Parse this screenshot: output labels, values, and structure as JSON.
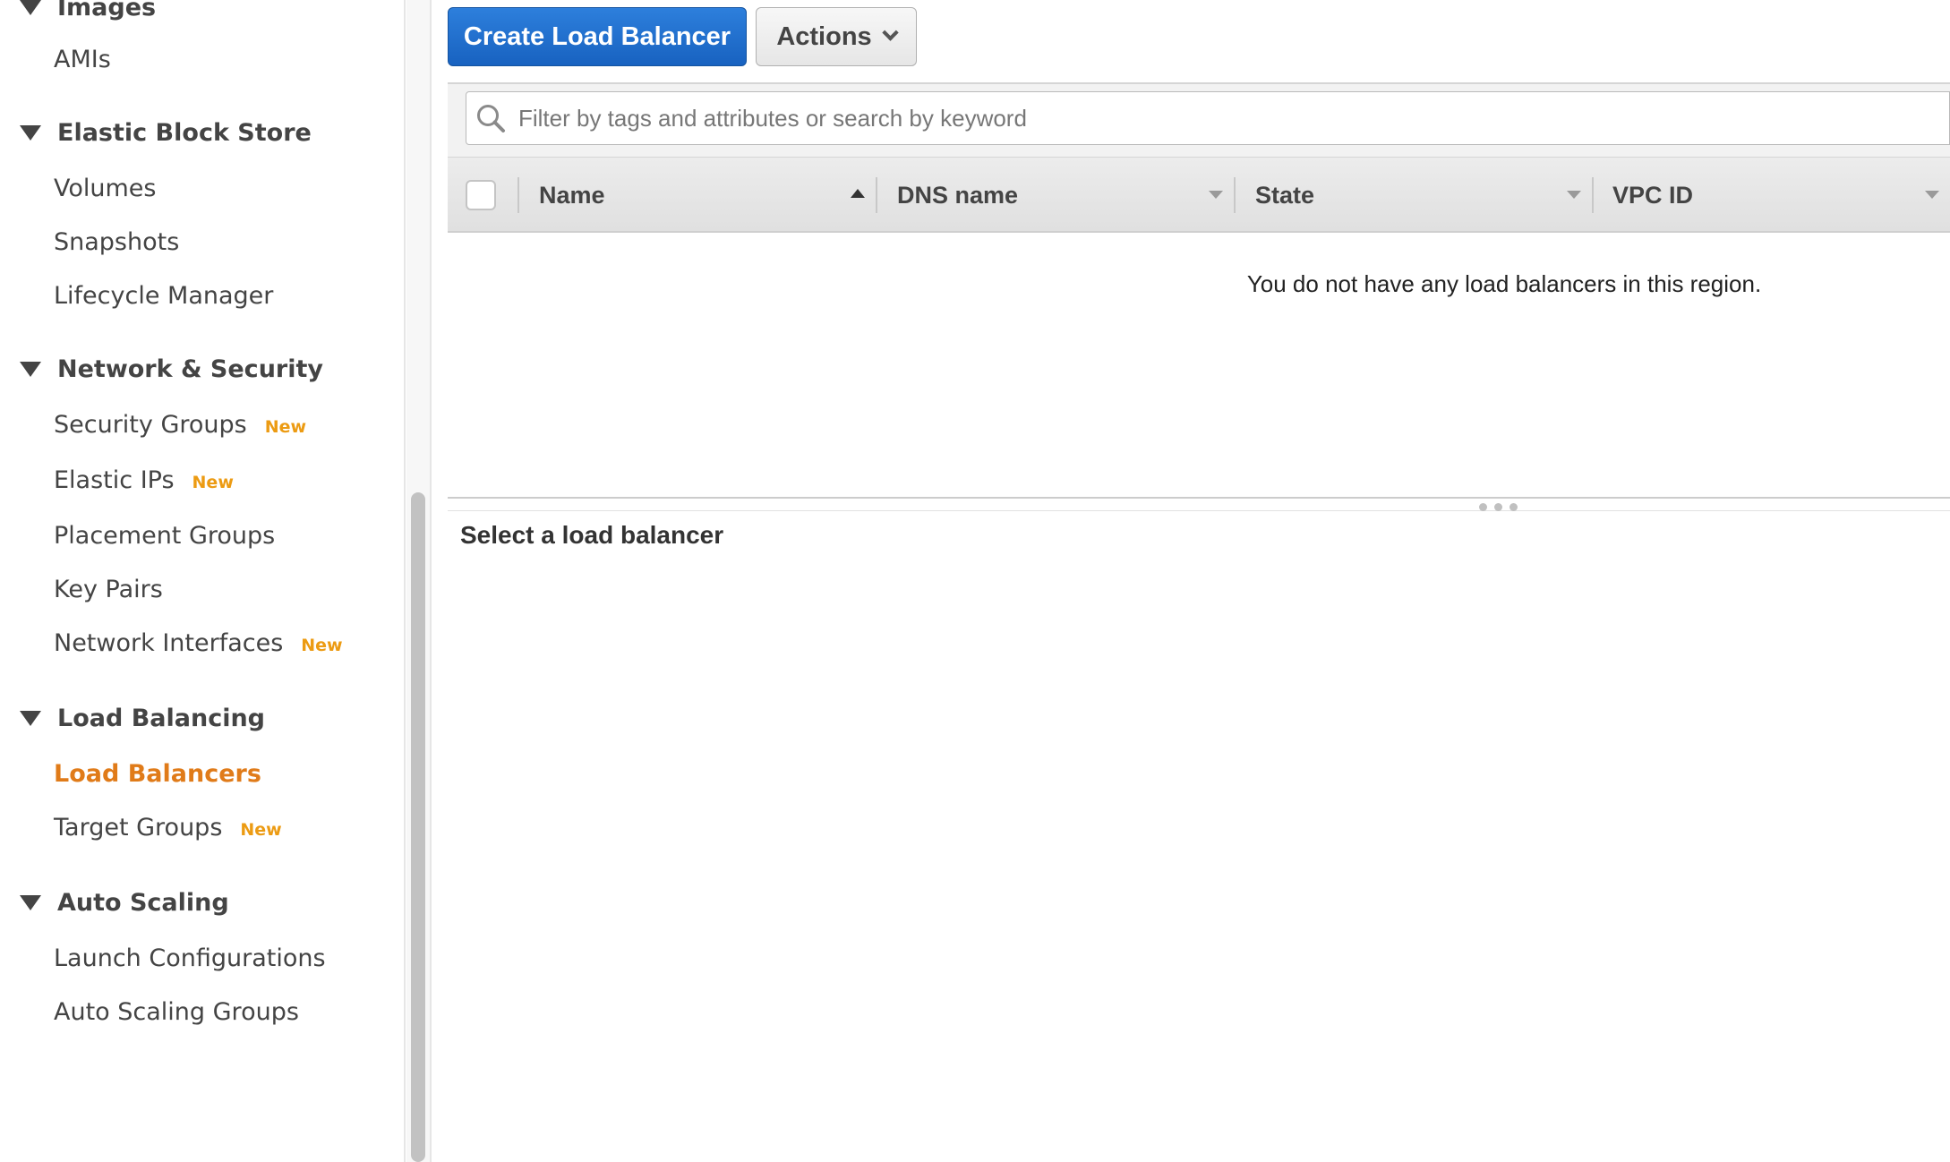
{
  "sidebar": {
    "sections": [
      {
        "title": "Images",
        "items": [
          {
            "label": "AMIs",
            "badge": ""
          }
        ]
      },
      {
        "title": "Elastic Block Store",
        "items": [
          {
            "label": "Volumes",
            "badge": ""
          },
          {
            "label": "Snapshots",
            "badge": ""
          },
          {
            "label": "Lifecycle Manager",
            "badge": ""
          }
        ]
      },
      {
        "title": "Network & Security",
        "items": [
          {
            "label": "Security Groups",
            "badge": "New"
          },
          {
            "label": "Elastic IPs",
            "badge": "New"
          },
          {
            "label": "Placement Groups",
            "badge": ""
          },
          {
            "label": "Key Pairs",
            "badge": ""
          },
          {
            "label": "Network Interfaces",
            "badge": "New"
          }
        ]
      },
      {
        "title": "Load Balancing",
        "items": [
          {
            "label": "Load Balancers",
            "badge": "",
            "active": true
          },
          {
            "label": "Target Groups",
            "badge": "New"
          }
        ]
      },
      {
        "title": "Auto Scaling",
        "items": [
          {
            "label": "Launch Configurations",
            "badge": ""
          },
          {
            "label": "Auto Scaling Groups",
            "badge": ""
          }
        ]
      }
    ]
  },
  "toolbar": {
    "create_label": "Create Load Balancer",
    "actions_label": "Actions"
  },
  "search": {
    "placeholder": "Filter by tags and attributes or search by keyword",
    "value": ""
  },
  "table": {
    "columns": [
      "Name",
      "DNS name",
      "State",
      "VPC ID"
    ],
    "sorted_column": "Name",
    "sort_direction": "ascending",
    "rows": [],
    "empty_message": "You do not have any load balancers in this region."
  },
  "detail": {
    "title": "Select a load balancer"
  },
  "colors": {
    "primary_button": "#1f6fd1",
    "active_nav": "#e07b19",
    "new_badge": "#ec9b13"
  }
}
